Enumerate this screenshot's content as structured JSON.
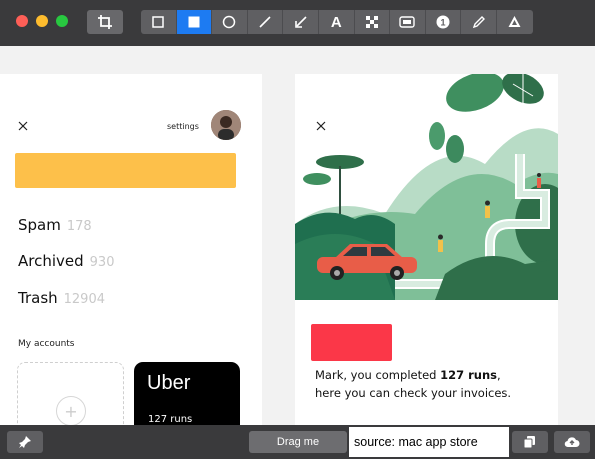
{
  "toolbar": {
    "tools": [
      {
        "name": "rectangle-tool",
        "icon": "square-outline-icon"
      },
      {
        "name": "filled-rectangle-tool",
        "icon": "square-filled-icon",
        "active": true
      },
      {
        "name": "ellipse-tool",
        "icon": "circle-outline-icon"
      },
      {
        "name": "line-tool",
        "icon": "line-icon"
      },
      {
        "name": "arrow-tool",
        "icon": "arrow-icon"
      },
      {
        "name": "text-tool",
        "icon": "text-a-icon",
        "label": "A"
      },
      {
        "name": "pixelate-tool",
        "icon": "mosaic-icon"
      },
      {
        "name": "highlight-tool",
        "icon": "highlight-box-icon"
      },
      {
        "name": "counter-tool",
        "icon": "number-circle-icon",
        "label": "1"
      },
      {
        "name": "pencil-tool",
        "icon": "pencil-icon"
      },
      {
        "name": "recycle-tool",
        "icon": "recycle-icon"
      }
    ],
    "accent": "#1d7bf2"
  },
  "left_app": {
    "settings_label": "settings",
    "folders": [
      {
        "label": "Spam",
        "count": "178"
      },
      {
        "label": "Archived",
        "count": "930"
      },
      {
        "label": "Trash",
        "count": "12904"
      }
    ],
    "my_accounts_label": "My accounts",
    "uber_card": {
      "logo": "Uber",
      "runs": "127 runs"
    },
    "colors": {
      "yellow": "#fdc04a"
    }
  },
  "right_app": {
    "message_prefix": "Mark, you completed ",
    "message_bold": "127 runs",
    "message_suffix": ",",
    "message_line2": "here you can check your invoices.",
    "colors": {
      "red": "#fb3748",
      "car": "#e85d48"
    }
  },
  "bottom": {
    "drag_label": "Drag me",
    "source_label": "source: mac app store"
  }
}
